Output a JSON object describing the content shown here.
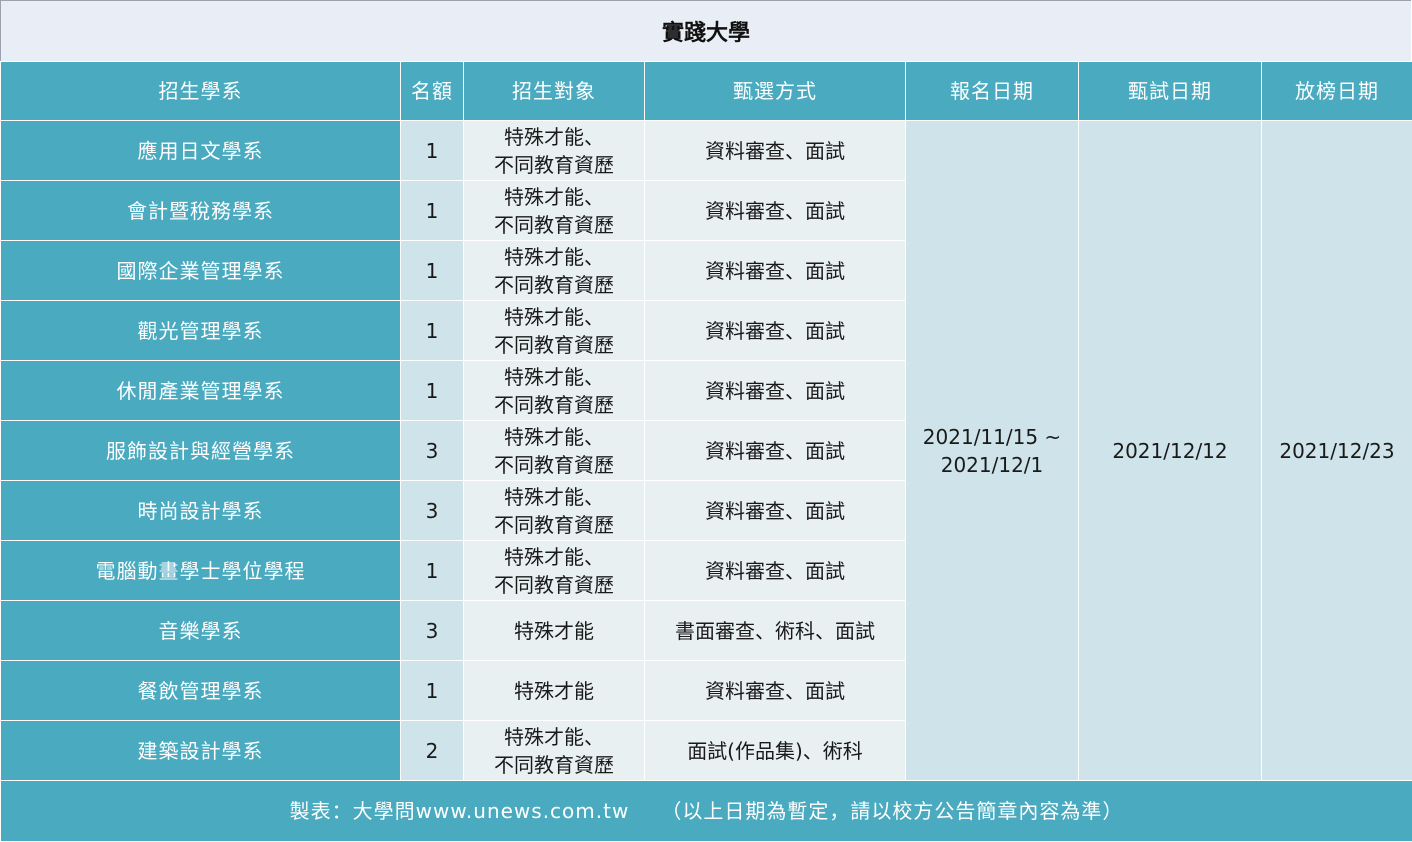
{
  "title": "實踐大學",
  "headers": [
    "招生學系",
    "名額",
    "招生對象",
    "甄選方式",
    "報名日期",
    "甄試日期",
    "放榜日期"
  ],
  "rows": [
    {
      "dept": "應用日文學系",
      "quota": "1",
      "target": [
        "特殊才能、",
        "不同教育資歷"
      ],
      "method": "資料審查、面試"
    },
    {
      "dept": "會計暨稅務學系",
      "quota": "1",
      "target": [
        "特殊才能、",
        "不同教育資歷"
      ],
      "method": "資料審查、面試"
    },
    {
      "dept": "國際企業管理學系",
      "quota": "1",
      "target": [
        "特殊才能、",
        "不同教育資歷"
      ],
      "method": "資料審查、面試"
    },
    {
      "dept": "觀光管理學系",
      "quota": "1",
      "target": [
        "特殊才能、",
        "不同教育資歷"
      ],
      "method": "資料審查、面試"
    },
    {
      "dept": "休閒產業管理學系",
      "quota": "1",
      "target": [
        "特殊才能、",
        "不同教育資歷"
      ],
      "method": "資料審查、面試"
    },
    {
      "dept": "服飾設計與經營學系",
      "quota": "3",
      "target": [
        "特殊才能、",
        "不同教育資歷"
      ],
      "method": "資料審查、面試"
    },
    {
      "dept": "時尚設計學系",
      "quota": "3",
      "target": [
        "特殊才能、",
        "不同教育資歷"
      ],
      "method": "資料審查、面試"
    },
    {
      "dept": "電腦動畫學士學位學程",
      "quota": "1",
      "target": [
        "特殊才能、",
        "不同教育資歷"
      ],
      "method": "資料審查、面試"
    },
    {
      "dept": "音樂學系",
      "quota": "3",
      "target": [
        "特殊才能"
      ],
      "method": "書面審查、術科、面試"
    },
    {
      "dept": "餐飲管理學系",
      "quota": "1",
      "target": [
        "特殊才能"
      ],
      "method": "資料審查、面試"
    },
    {
      "dept": "建築設計學系",
      "quota": "2",
      "target": [
        "特殊才能、",
        "不同教育資歷"
      ],
      "method": "面試(作品集)、術科"
    }
  ],
  "dates": {
    "register": [
      "2021/11/15 ~",
      "2021/12/1"
    ],
    "exam": "2021/12/12",
    "announce": "2021/12/23"
  },
  "footer": "製表：大學問www.unews.com.tw　　（以上日期為暫定，請以校方公告簡章內容為準）"
}
